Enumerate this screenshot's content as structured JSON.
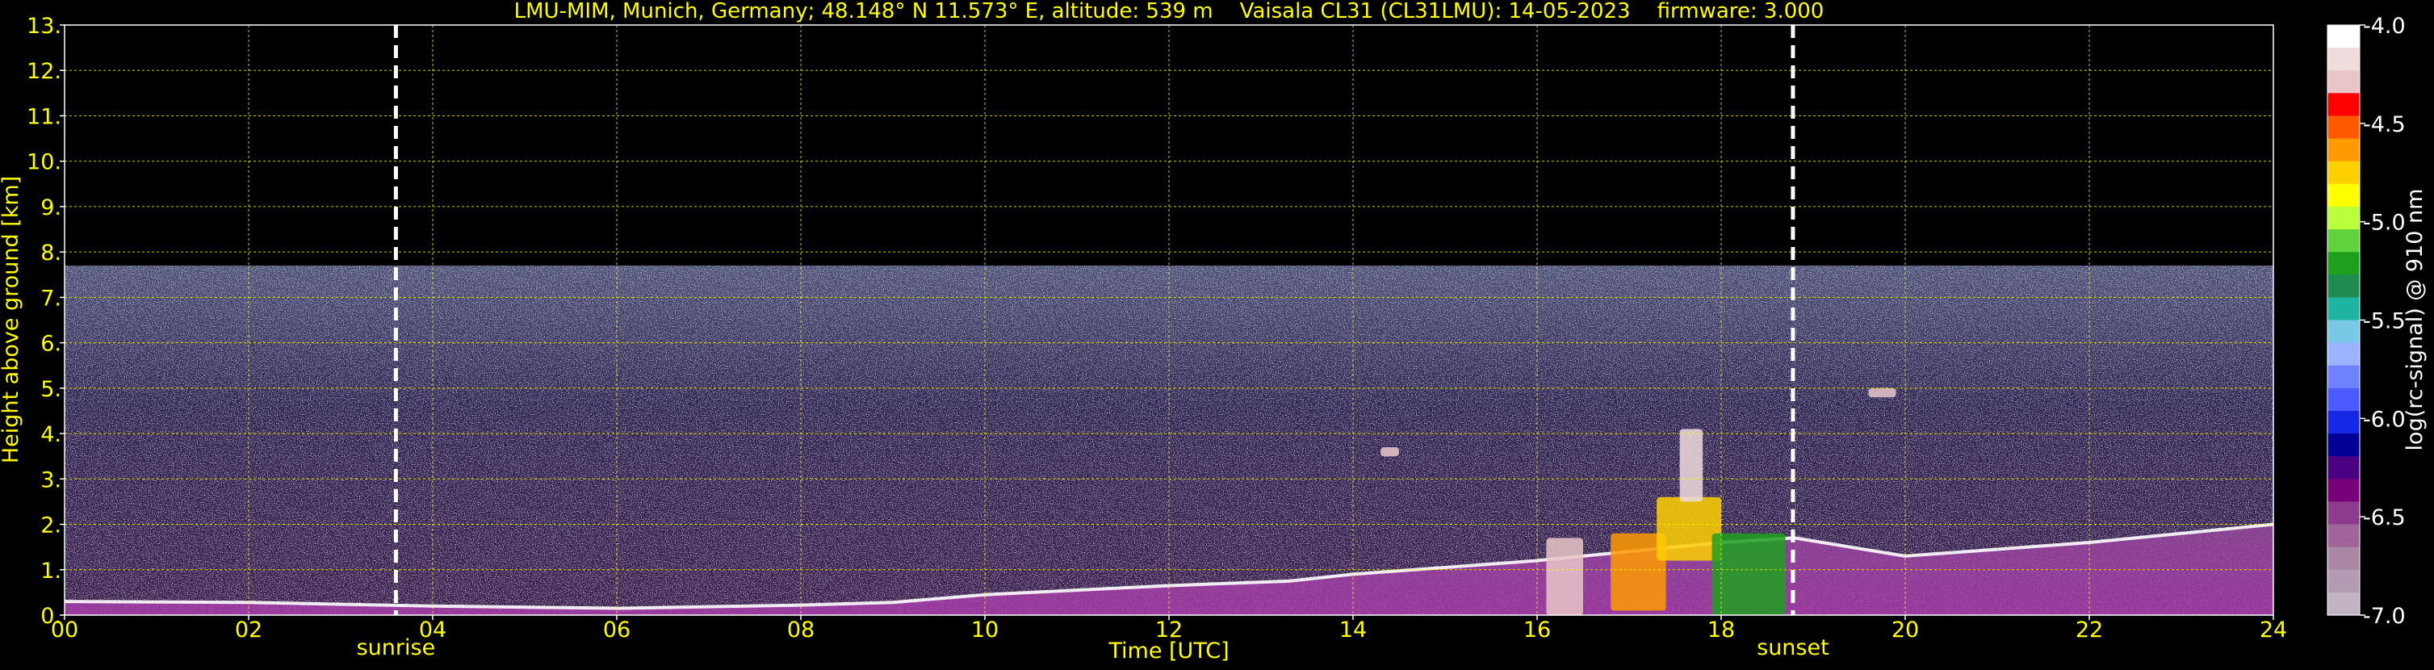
{
  "chart_data": {
    "type": "heatmap",
    "title": "LMU-MIM, Munich, Germany; 48.148° N 11.573° E, altitude: 539 m    Vaisala CL31 (CL31LMU): 14-05-2023    firmware: 3.000",
    "xlabel": "Time [UTC]",
    "ylabel": "Height above ground [km]",
    "xlim": [
      0,
      24
    ],
    "ylim": [
      0,
      13
    ],
    "x_ticks": [
      "00",
      "02",
      "04",
      "06",
      "08",
      "10",
      "12",
      "14",
      "16",
      "18",
      "20",
      "22",
      "24"
    ],
    "y_ticks": [
      "0.",
      "1.",
      "2.",
      "3.",
      "4.",
      "5.",
      "6.",
      "7.",
      "8.",
      "9.",
      "10.",
      "11.",
      "12.",
      "13."
    ],
    "grid": true,
    "colorbar": {
      "label": "log(rc-signal) @ 910 nm",
      "range": [
        -7.0,
        -4.0
      ],
      "ticks": [
        "-4.0",
        "-4.5",
        "-5.0",
        "-5.5",
        "-6.0",
        "-6.5",
        "-7.0"
      ],
      "colors": [
        "#ffffff",
        "#f0dcdc",
        "#e9c5c8",
        "#ff0000",
        "#ff5a00",
        "#ff9a00",
        "#ffd000",
        "#ffff00",
        "#b9ff3c",
        "#5fd23c",
        "#1ea01e",
        "#1e8c50",
        "#1eb4a0",
        "#78c8e6",
        "#9ab4ff",
        "#6e82ff",
        "#4b5aff",
        "#1428e6",
        "#000096",
        "#4b0082",
        "#780078",
        "#8c3c8c",
        "#a0649b",
        "#aa87a5",
        "#b49bb4",
        "#c3b4c3"
      ]
    },
    "annotations": [
      {
        "label": "sunrise",
        "x": 3.6
      },
      {
        "label": "sunset",
        "x": 18.78
      }
    ],
    "layers": {
      "noise_top_km": 7.7,
      "boundary_layer": [
        [
          0,
          0.3
        ],
        [
          2,
          0.28
        ],
        [
          4,
          0.2
        ],
        [
          6,
          0.15
        ],
        [
          8,
          0.22
        ],
        [
          9,
          0.28
        ],
        [
          10,
          0.45
        ],
        [
          12,
          0.65
        ],
        [
          13.3,
          0.75
        ],
        [
          14,
          0.9
        ],
        [
          16,
          1.2
        ],
        [
          18,
          1.6
        ],
        [
          18.8,
          1.7
        ],
        [
          20,
          1.3
        ],
        [
          22,
          1.6
        ],
        [
          24,
          2.0
        ]
      ],
      "clouds": [
        {
          "x0": 16.1,
          "x1": 16.5,
          "y0": 0.0,
          "y1": 1.7,
          "level": -4.3
        },
        {
          "x0": 16.8,
          "x1": 17.4,
          "y0": 0.1,
          "y1": 1.8,
          "level": -4.6
        },
        {
          "x0": 17.3,
          "x1": 18.0,
          "y0": 1.2,
          "y1": 2.6,
          "level": -4.8
        },
        {
          "x0": 17.55,
          "x1": 17.8,
          "y0": 2.5,
          "y1": 4.1,
          "level": -4.2
        },
        {
          "x0": 17.9,
          "x1": 18.7,
          "y0": 0.0,
          "y1": 1.8,
          "level": -5.2
        },
        {
          "x0": 14.3,
          "x1": 14.5,
          "y0": 3.5,
          "y1": 3.7,
          "level": -4.3
        },
        {
          "x0": 19.6,
          "x1": 19.9,
          "y0": 4.8,
          "y1": 5.0,
          "level": -4.3
        }
      ]
    }
  }
}
